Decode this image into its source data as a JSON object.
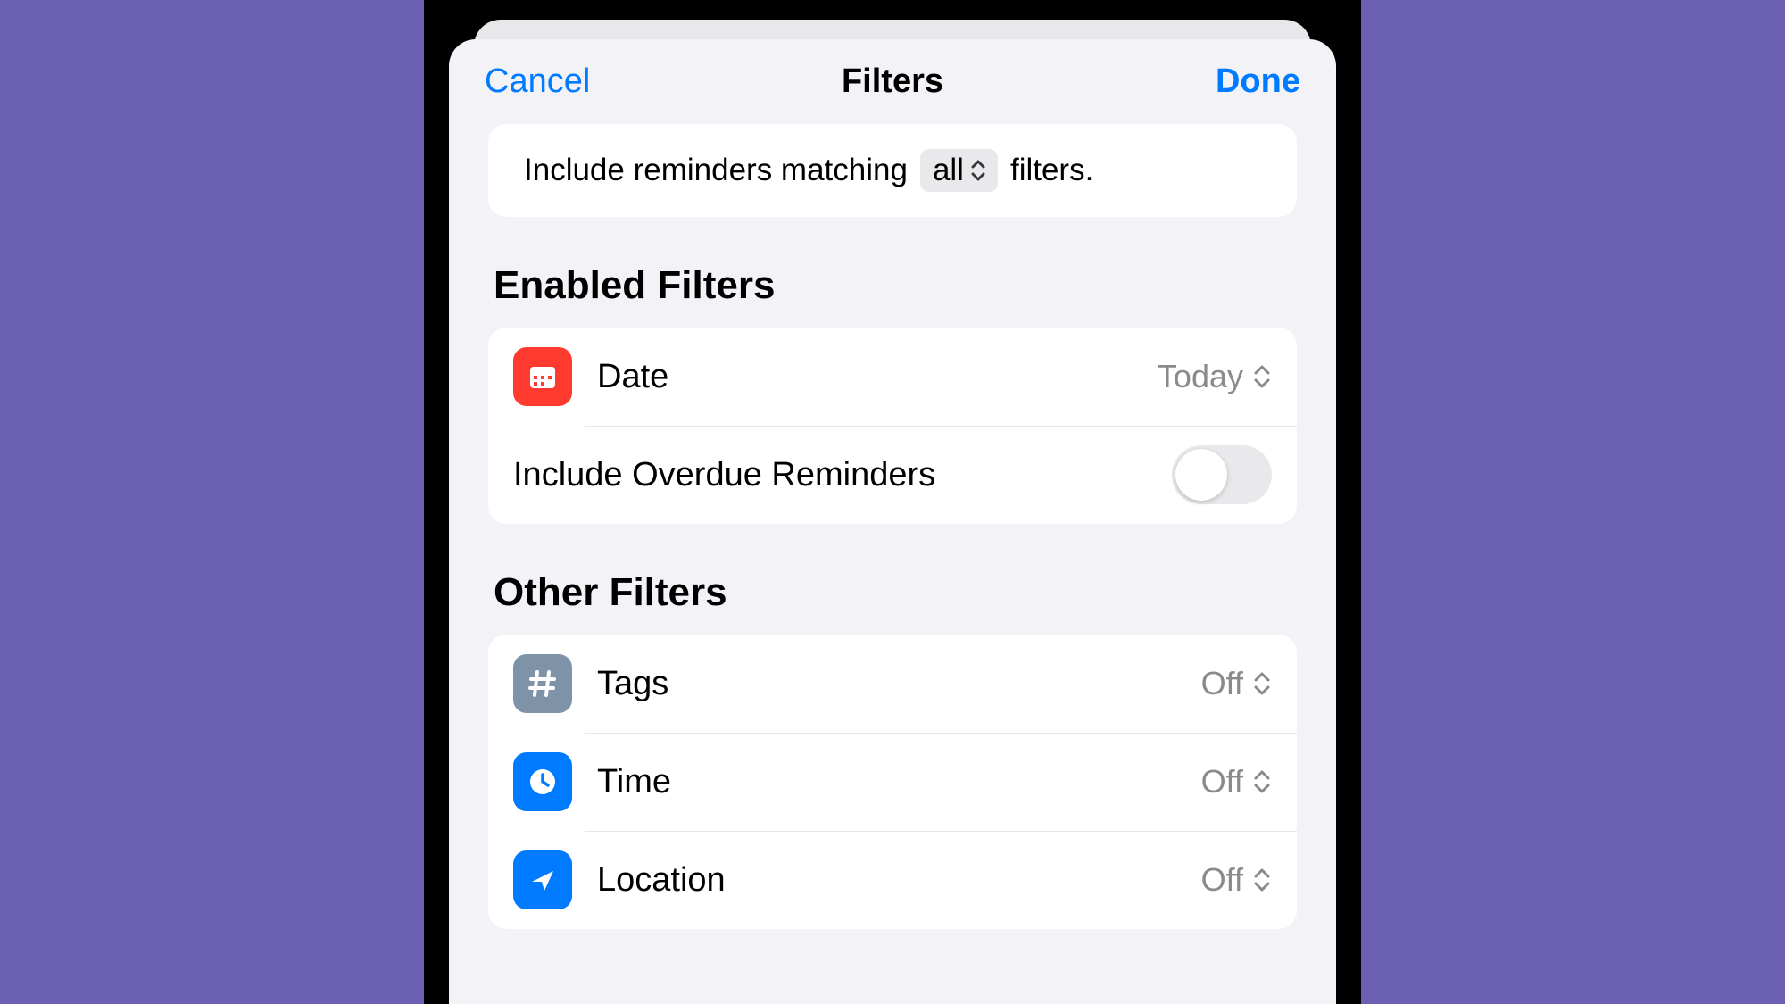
{
  "nav": {
    "cancel": "Cancel",
    "title": "Filters",
    "done": "Done"
  },
  "match": {
    "prefix": "Include reminders matching",
    "mode": "all",
    "suffix": "filters."
  },
  "sections": {
    "enabled_title": "Enabled Filters",
    "other_title": "Other Filters"
  },
  "enabled": {
    "date": {
      "label": "Date",
      "value": "Today"
    },
    "overdue": {
      "label": "Include Overdue Reminders",
      "on": false
    }
  },
  "other": {
    "tags": {
      "label": "Tags",
      "value": "Off"
    },
    "time": {
      "label": "Time",
      "value": "Off"
    },
    "location": {
      "label": "Location",
      "value": "Off"
    }
  },
  "colors": {
    "accent": "#007aff",
    "red": "#ff3b30",
    "slate": "#7e92a8"
  }
}
